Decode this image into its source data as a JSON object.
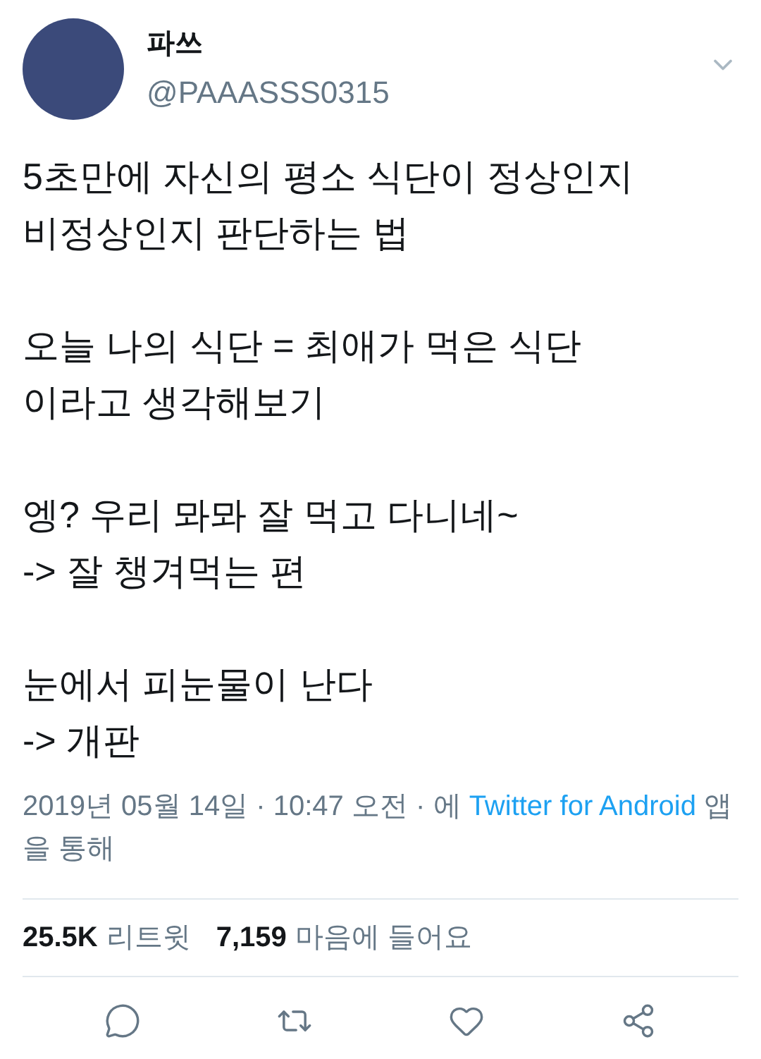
{
  "author": {
    "name": "파쓰",
    "handle": "@PAAASSS0315"
  },
  "body": [
    [
      "5초만에 자신의 평소 식단이 정상인지",
      "비정상인지 판단하는 법"
    ],
    [
      "오늘 나의 식단 = 최애가 먹은 식단",
      "이라고 생각해보기"
    ],
    [
      "엥? 우리 뫄뫄 잘 먹고 다니네~",
      "-> 잘 챙겨먹는 편"
    ],
    [
      "눈에서 피눈물이 난다",
      "-> 개판"
    ]
  ],
  "meta": {
    "before": "2019년 05월 14일 · 10:47 오전 · 에",
    "link": "Twitter for Android",
    "after": "앱을 통해"
  },
  "stats": [
    {
      "count": "25.5K",
      "label": "리트윗"
    },
    {
      "count": "7,159",
      "label": "마음에 들어요"
    }
  ]
}
